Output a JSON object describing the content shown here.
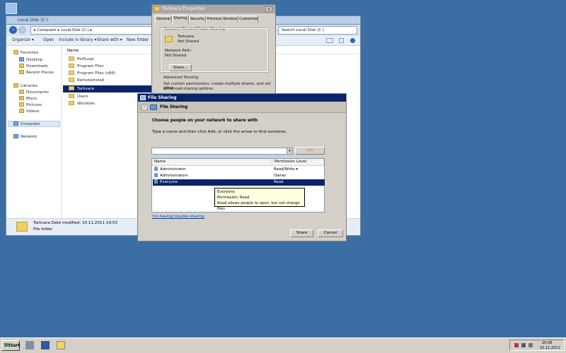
{
  "desktop": {
    "background": "#3a6ea5",
    "icons": [
      {
        "name": "recycle-bin-icon"
      }
    ]
  },
  "explorer": {
    "title": "Local Disk (C:)",
    "address": "▸ Computer ▸ Local Disk (C:) ▸",
    "search_placeholder": "Search Local Disk (C:)",
    "toolbar": [
      "Organize ▾",
      "Open",
      "Include in library ▾",
      "Share with ▾",
      "New folder"
    ],
    "nav": {
      "favorites": "Favorites",
      "favorites_items": [
        "Desktop",
        "Downloads",
        "Recent Places"
      ],
      "libraries": "Libraries",
      "libraries_items": [
        "Documents",
        "Music",
        "Pictures",
        "Videos"
      ],
      "computer": "Computer",
      "network": "Network"
    },
    "column_name": "Name",
    "files": [
      "PerfLogs",
      "Program Files",
      "Program Files (x86)",
      "RemoteInstall",
      "Tarkvara",
      "Users",
      "Windows"
    ],
    "selected_file": "Tarkvara",
    "details": {
      "line1": "Tarkvara Date modified: 10.11.2011 19:53",
      "line2": "File folder"
    }
  },
  "properties": {
    "title": "Tarkvara Properties",
    "tabs": [
      "General",
      "Sharing",
      "Security",
      "Previous Versions",
      "Customize"
    ],
    "active_tab": "Sharing",
    "section1": "Network File and Folder Sharing",
    "folder_name": "Tarkvara",
    "folder_state": "Not Shared",
    "network_path_label": "Network Path:",
    "network_path_value": "Not Shared",
    "share_button": "Share...",
    "section2": "Advanced Sharing",
    "adv_text1": "Set custom permissions, create multiple shares, and set other",
    "adv_text2": "advanced sharing options."
  },
  "file_sharing": {
    "title": "File Sharing",
    "header": "File Sharing",
    "choose": "Choose people on your network to share with",
    "type_hint": "Type a name and then click Add, or click the arrow to find someone.",
    "add_label": "Add",
    "col_name": "Name",
    "col_perm": "Permission Level",
    "rows": [
      {
        "name": "Administrator",
        "perm": "Read/Write ▾"
      },
      {
        "name": "Administrators",
        "perm": "Owner"
      },
      {
        "name": "Everyone",
        "perm": "Read"
      }
    ],
    "tooltip": [
      "Everyone",
      "Permission: Read",
      "Read allows people to open, but not change files"
    ],
    "trouble_link": "I'm having trouble sharing",
    "share_button": "Share",
    "cancel_button": "Cancel"
  },
  "taskbar": {
    "start": "Start",
    "clock_time": "20:08",
    "clock_date": "10.11.2011"
  },
  "colors": {
    "selection": "#0a246a",
    "window_face": "#d4d0c8",
    "desktop": "#3a6ea5"
  }
}
